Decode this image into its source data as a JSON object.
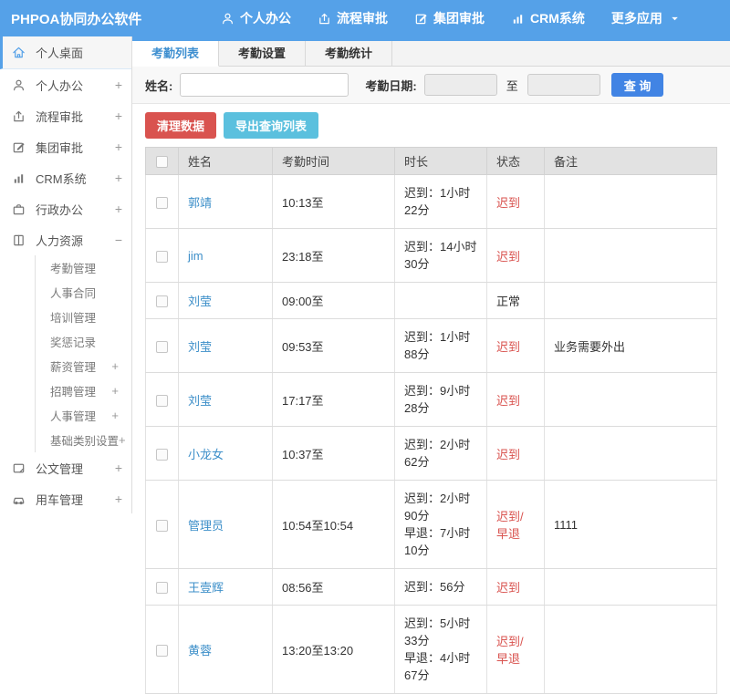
{
  "colors": {
    "topbar_blue": "#55A1E8",
    "accent_blue": "#4184E4",
    "link_blue": "#3D8FC9",
    "danger_red": "#D9534F",
    "info_teal": "#5BC0DE",
    "status_red": "#D9534F"
  },
  "topbar": {
    "title": "PHPOA协同办公软件",
    "menu_icon": "hamburger-menu-icon",
    "nav": [
      {
        "key": "personal-office",
        "label": "个人办公",
        "icon": "person-icon"
      },
      {
        "key": "workflow-approval",
        "label": "流程审批",
        "icon": "workflow-icon"
      },
      {
        "key": "group-approval",
        "label": "集团审批",
        "icon": "edit-icon"
      },
      {
        "key": "crm-system",
        "label": "CRM系统",
        "icon": "bar-chart-icon"
      },
      {
        "key": "more-apps",
        "label": "更多应用",
        "icon": "caret-down-icon",
        "caret": true
      }
    ]
  },
  "sidebar": {
    "items": [
      {
        "key": "personal-desktop",
        "label": "个人桌面",
        "icon": "home-icon",
        "active": true,
        "suffix": ""
      },
      {
        "key": "personal-office",
        "label": "个人办公",
        "icon": "person-icon",
        "suffix": "+"
      },
      {
        "key": "workflow-approval",
        "label": "流程审批",
        "icon": "workflow-icon",
        "suffix": "+"
      },
      {
        "key": "group-approval",
        "label": "集团审批",
        "icon": "edit-icon",
        "suffix": "+"
      },
      {
        "key": "crm-system",
        "label": "CRM系统",
        "icon": "bar-chart-icon",
        "suffix": "+"
      },
      {
        "key": "admin-office",
        "label": "行政办公",
        "icon": "briefcase-icon",
        "suffix": "+"
      },
      {
        "key": "human-resources",
        "label": "人力资源",
        "icon": "book-icon",
        "suffix": "−",
        "expanded": true,
        "children": [
          {
            "key": "attendance-management",
            "label": "考勤管理",
            "suffix": ""
          },
          {
            "key": "personnel-contract",
            "label": "人事合同",
            "suffix": ""
          },
          {
            "key": "training-management",
            "label": "培训管理",
            "suffix": ""
          },
          {
            "key": "reward-punishment",
            "label": "奖惩记录",
            "suffix": ""
          },
          {
            "key": "salary-management",
            "label": "薪资管理",
            "suffix": "+"
          },
          {
            "key": "recruitment-management",
            "label": "招聘管理",
            "suffix": "+"
          },
          {
            "key": "personnel-management",
            "label": "人事管理",
            "suffix": "+"
          },
          {
            "key": "base-category-settings",
            "label": "基础类别设置",
            "suffix": "+"
          }
        ]
      },
      {
        "key": "document-management",
        "label": "公文管理",
        "icon": "document-icon",
        "suffix": "+"
      },
      {
        "key": "vehicle-management",
        "label": "用车管理",
        "icon": "car-icon",
        "suffix": "+"
      }
    ]
  },
  "tabs": [
    {
      "key": "attendance-list",
      "label": "考勤列表",
      "active": true
    },
    {
      "key": "attendance-setup",
      "label": "考勤设置",
      "active": false
    },
    {
      "key": "attendance-stats",
      "label": "考勤统计",
      "active": false
    }
  ],
  "filter": {
    "name_label": "姓名:",
    "name_value": "",
    "date_label": "考勤日期:",
    "date_from_value": "",
    "to_label": "至",
    "date_to_value": "",
    "search_button": "查 询"
  },
  "toolbar": {
    "clear_button": "清理数据",
    "export_button": "导出查询列表"
  },
  "table": {
    "columns": [
      "姓名",
      "考勤时间",
      "时长",
      "状态",
      "备注"
    ],
    "rows": [
      {
        "name": "郭靖",
        "time": "10:13至",
        "duration": [
          "迟到：1小时22分"
        ],
        "status": "迟到",
        "status_red": true,
        "note": ""
      },
      {
        "name": "jim",
        "time": "23:18至",
        "duration": [
          "迟到：14小时30分"
        ],
        "status": "迟到",
        "status_red": true,
        "note": ""
      },
      {
        "name": "刘莹",
        "time": "09:00至",
        "duration": [],
        "status": "正常",
        "status_red": false,
        "note": ""
      },
      {
        "name": "刘莹",
        "time": "09:53至",
        "duration": [
          "迟到：1小时88分"
        ],
        "status": "迟到",
        "status_red": true,
        "note": "业务需要外出"
      },
      {
        "name": "刘莹",
        "time": "17:17至",
        "duration": [
          "迟到：9小时28分"
        ],
        "status": "迟到",
        "status_red": true,
        "note": ""
      },
      {
        "name": "小龙女",
        "time": "10:37至",
        "duration": [
          "迟到：2小时62分"
        ],
        "status": "迟到",
        "status_red": true,
        "note": ""
      },
      {
        "name": "管理员",
        "time": "10:54至10:54",
        "duration": [
          "迟到：2小时90分",
          "早退：7小时10分"
        ],
        "status": "迟到/早退",
        "status_red": true,
        "note": "1111"
      },
      {
        "name": "王壹辉",
        "time": "08:56至",
        "duration": [
          "迟到：56分"
        ],
        "status": "迟到",
        "status_red": true,
        "note": ""
      },
      {
        "name": "黄蓉",
        "time": "13:20至13:20",
        "duration": [
          "迟到：5小时33分",
          "早退：4小时67分"
        ],
        "status": "迟到/早退",
        "status_red": true,
        "note": ""
      }
    ]
  }
}
